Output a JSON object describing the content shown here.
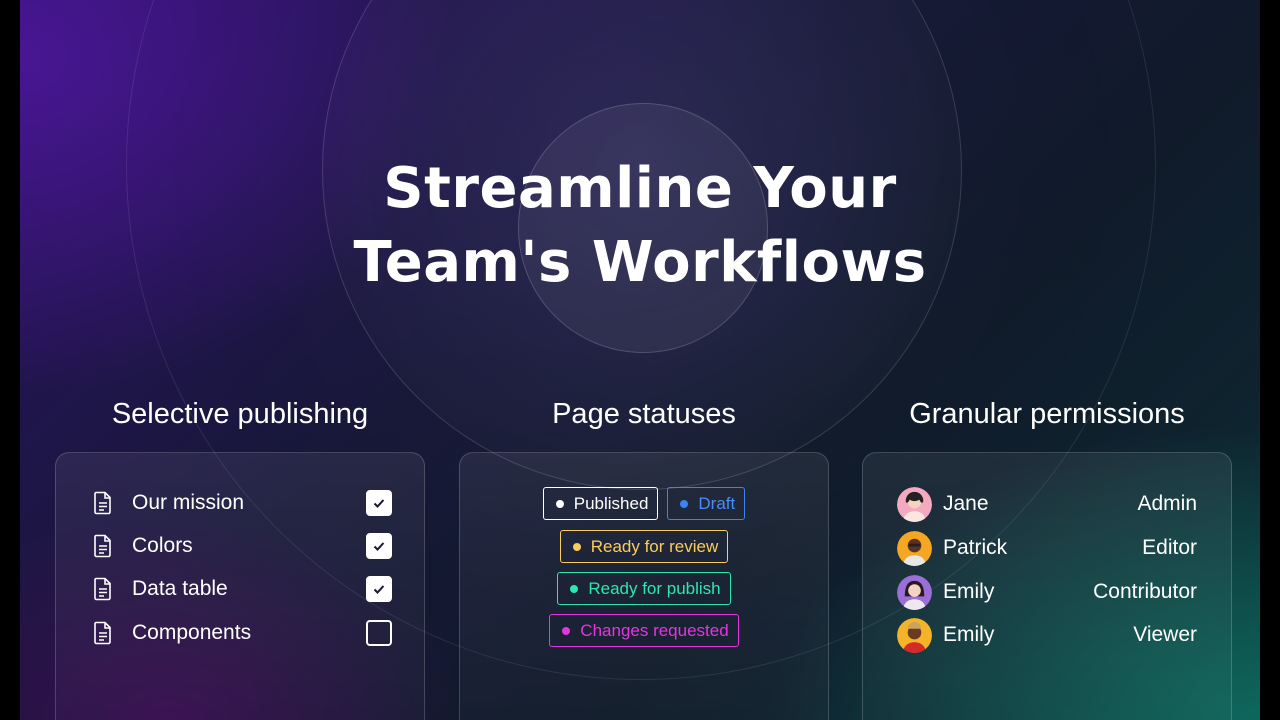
{
  "headline": {
    "line1": "Streamline Your",
    "line2": "Team's Workflows"
  },
  "columns": {
    "publishing": {
      "title": "Selective publishing",
      "items": [
        {
          "label": "Our mission",
          "checked": true
        },
        {
          "label": "Colors",
          "checked": true
        },
        {
          "label": "Data table",
          "checked": true
        },
        {
          "label": "Components",
          "checked": false
        }
      ]
    },
    "statuses": {
      "title": "Page statuses",
      "items": [
        {
          "label": "Published",
          "color": "#ffffff"
        },
        {
          "label": "Draft",
          "color": "#3b82f6"
        },
        {
          "label": "Ready for review",
          "color": "#facc5a"
        },
        {
          "label": "Ready for publish",
          "color": "#2ee6b0"
        },
        {
          "label": "Changes requested",
          "color": "#e535e0"
        }
      ]
    },
    "permissions": {
      "title": "Granular permissions",
      "users": [
        {
          "name": "Jane",
          "role": "Admin"
        },
        {
          "name": "Patrick",
          "role": "Editor"
        },
        {
          "name": "Emily",
          "role": "Contributor"
        },
        {
          "name": "Emily",
          "role": "Viewer"
        }
      ]
    }
  },
  "icons": {
    "document": "document-icon",
    "check": "check-icon"
  }
}
